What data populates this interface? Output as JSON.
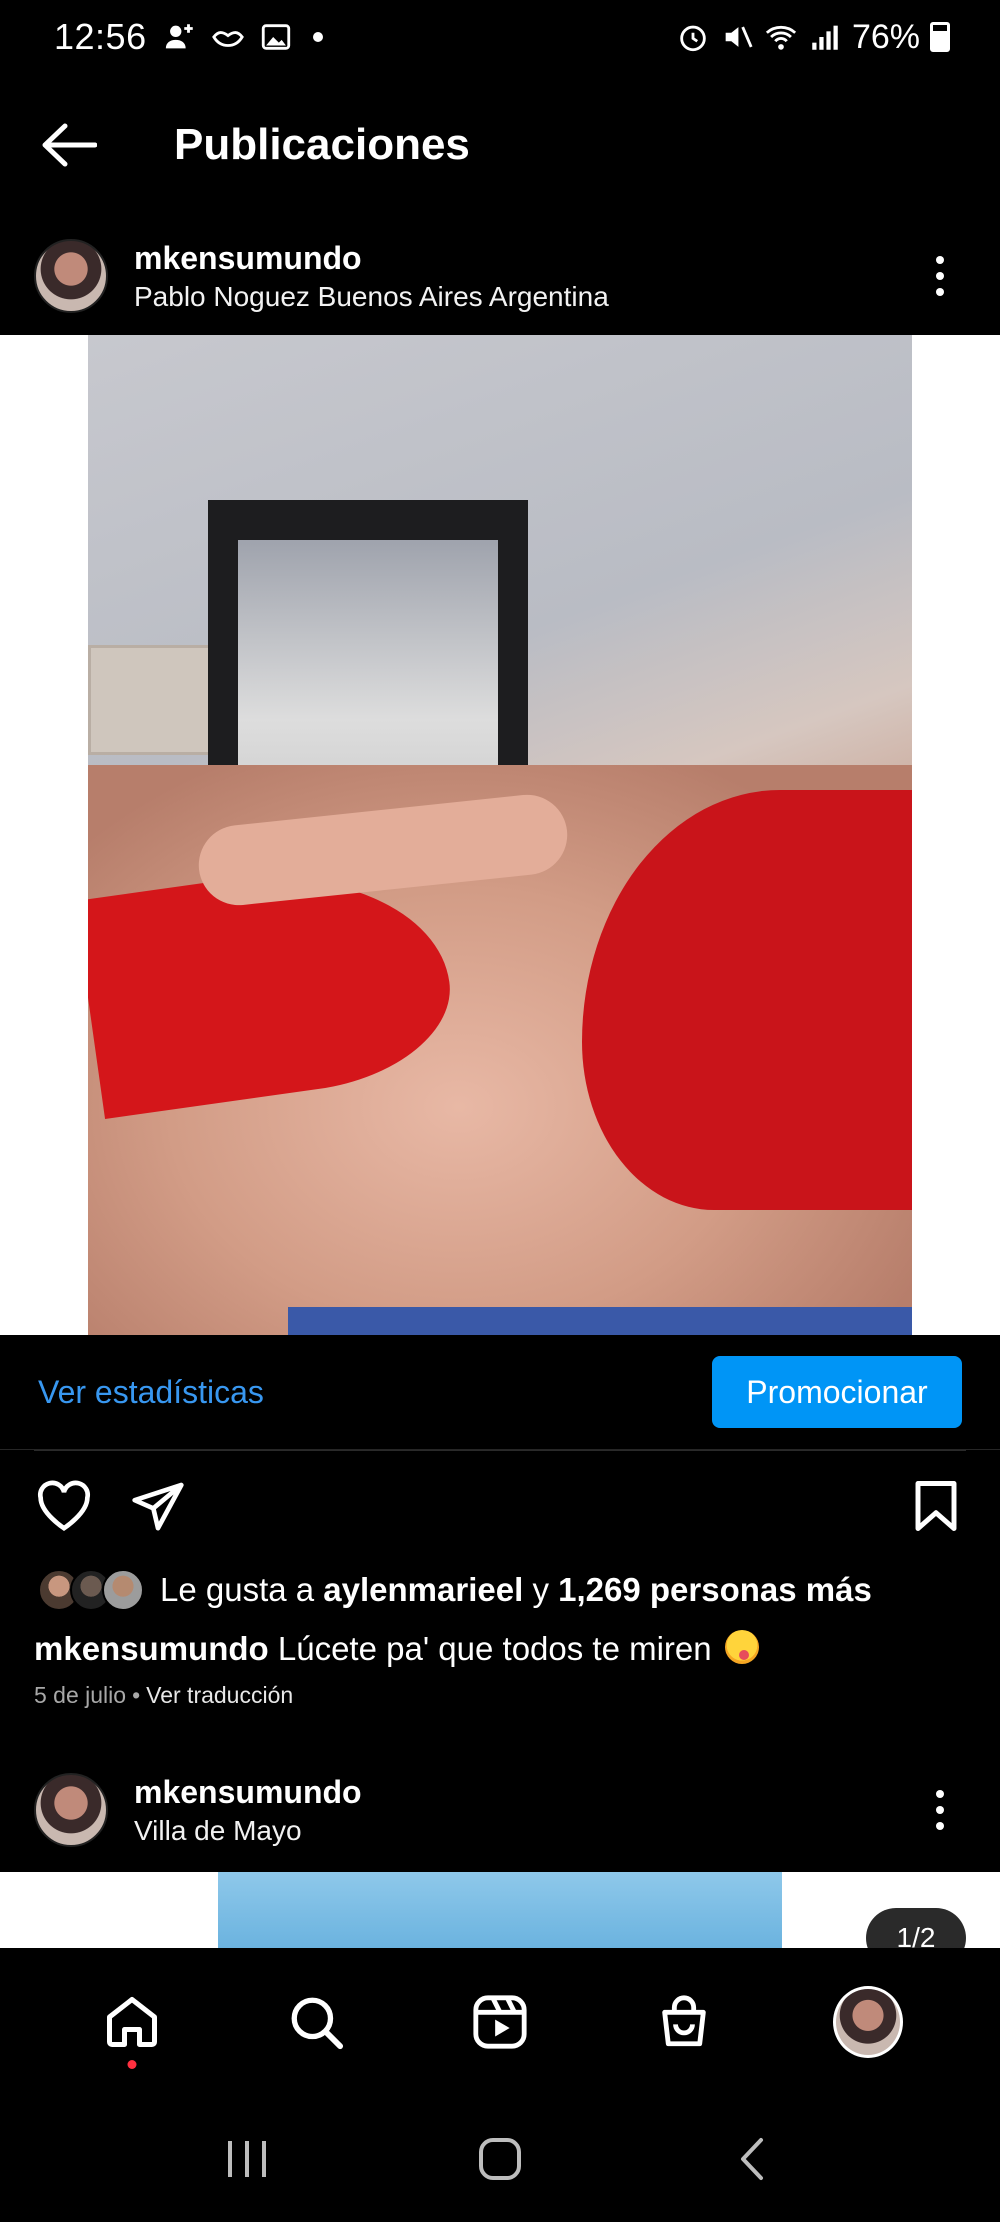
{
  "status_bar": {
    "time": "12:56",
    "battery": "76%"
  },
  "header": {
    "title": "Publicaciones"
  },
  "post1": {
    "username": "mkensumundo",
    "location": "Pablo Noguez Buenos Aires Argentina",
    "stats_link": "Ver estadísticas",
    "promote_label": "Promocionar",
    "likes_prefix": "Le gusta a",
    "likes_user": "aylenmarieel",
    "likes_and": "y",
    "likes_others": "1,269 personas más",
    "caption_user": "mkensumundo",
    "caption_text": "Lúcete pa' que todos te miren",
    "date": "5 de julio",
    "separator": "•",
    "translate": "Ver traducción"
  },
  "post2": {
    "username": "mkensumundo",
    "location": "Villa de Mayo",
    "carousel_counter": "1/2"
  },
  "nav": {
    "items": [
      "home-icon",
      "search-icon",
      "reels-icon",
      "shop-icon",
      "profile-avatar"
    ],
    "active": "home-icon",
    "notification_dot_color": "#ff3040"
  },
  "colors": {
    "accent": "#0095f6",
    "link": "#3897f0",
    "background": "#000000"
  }
}
